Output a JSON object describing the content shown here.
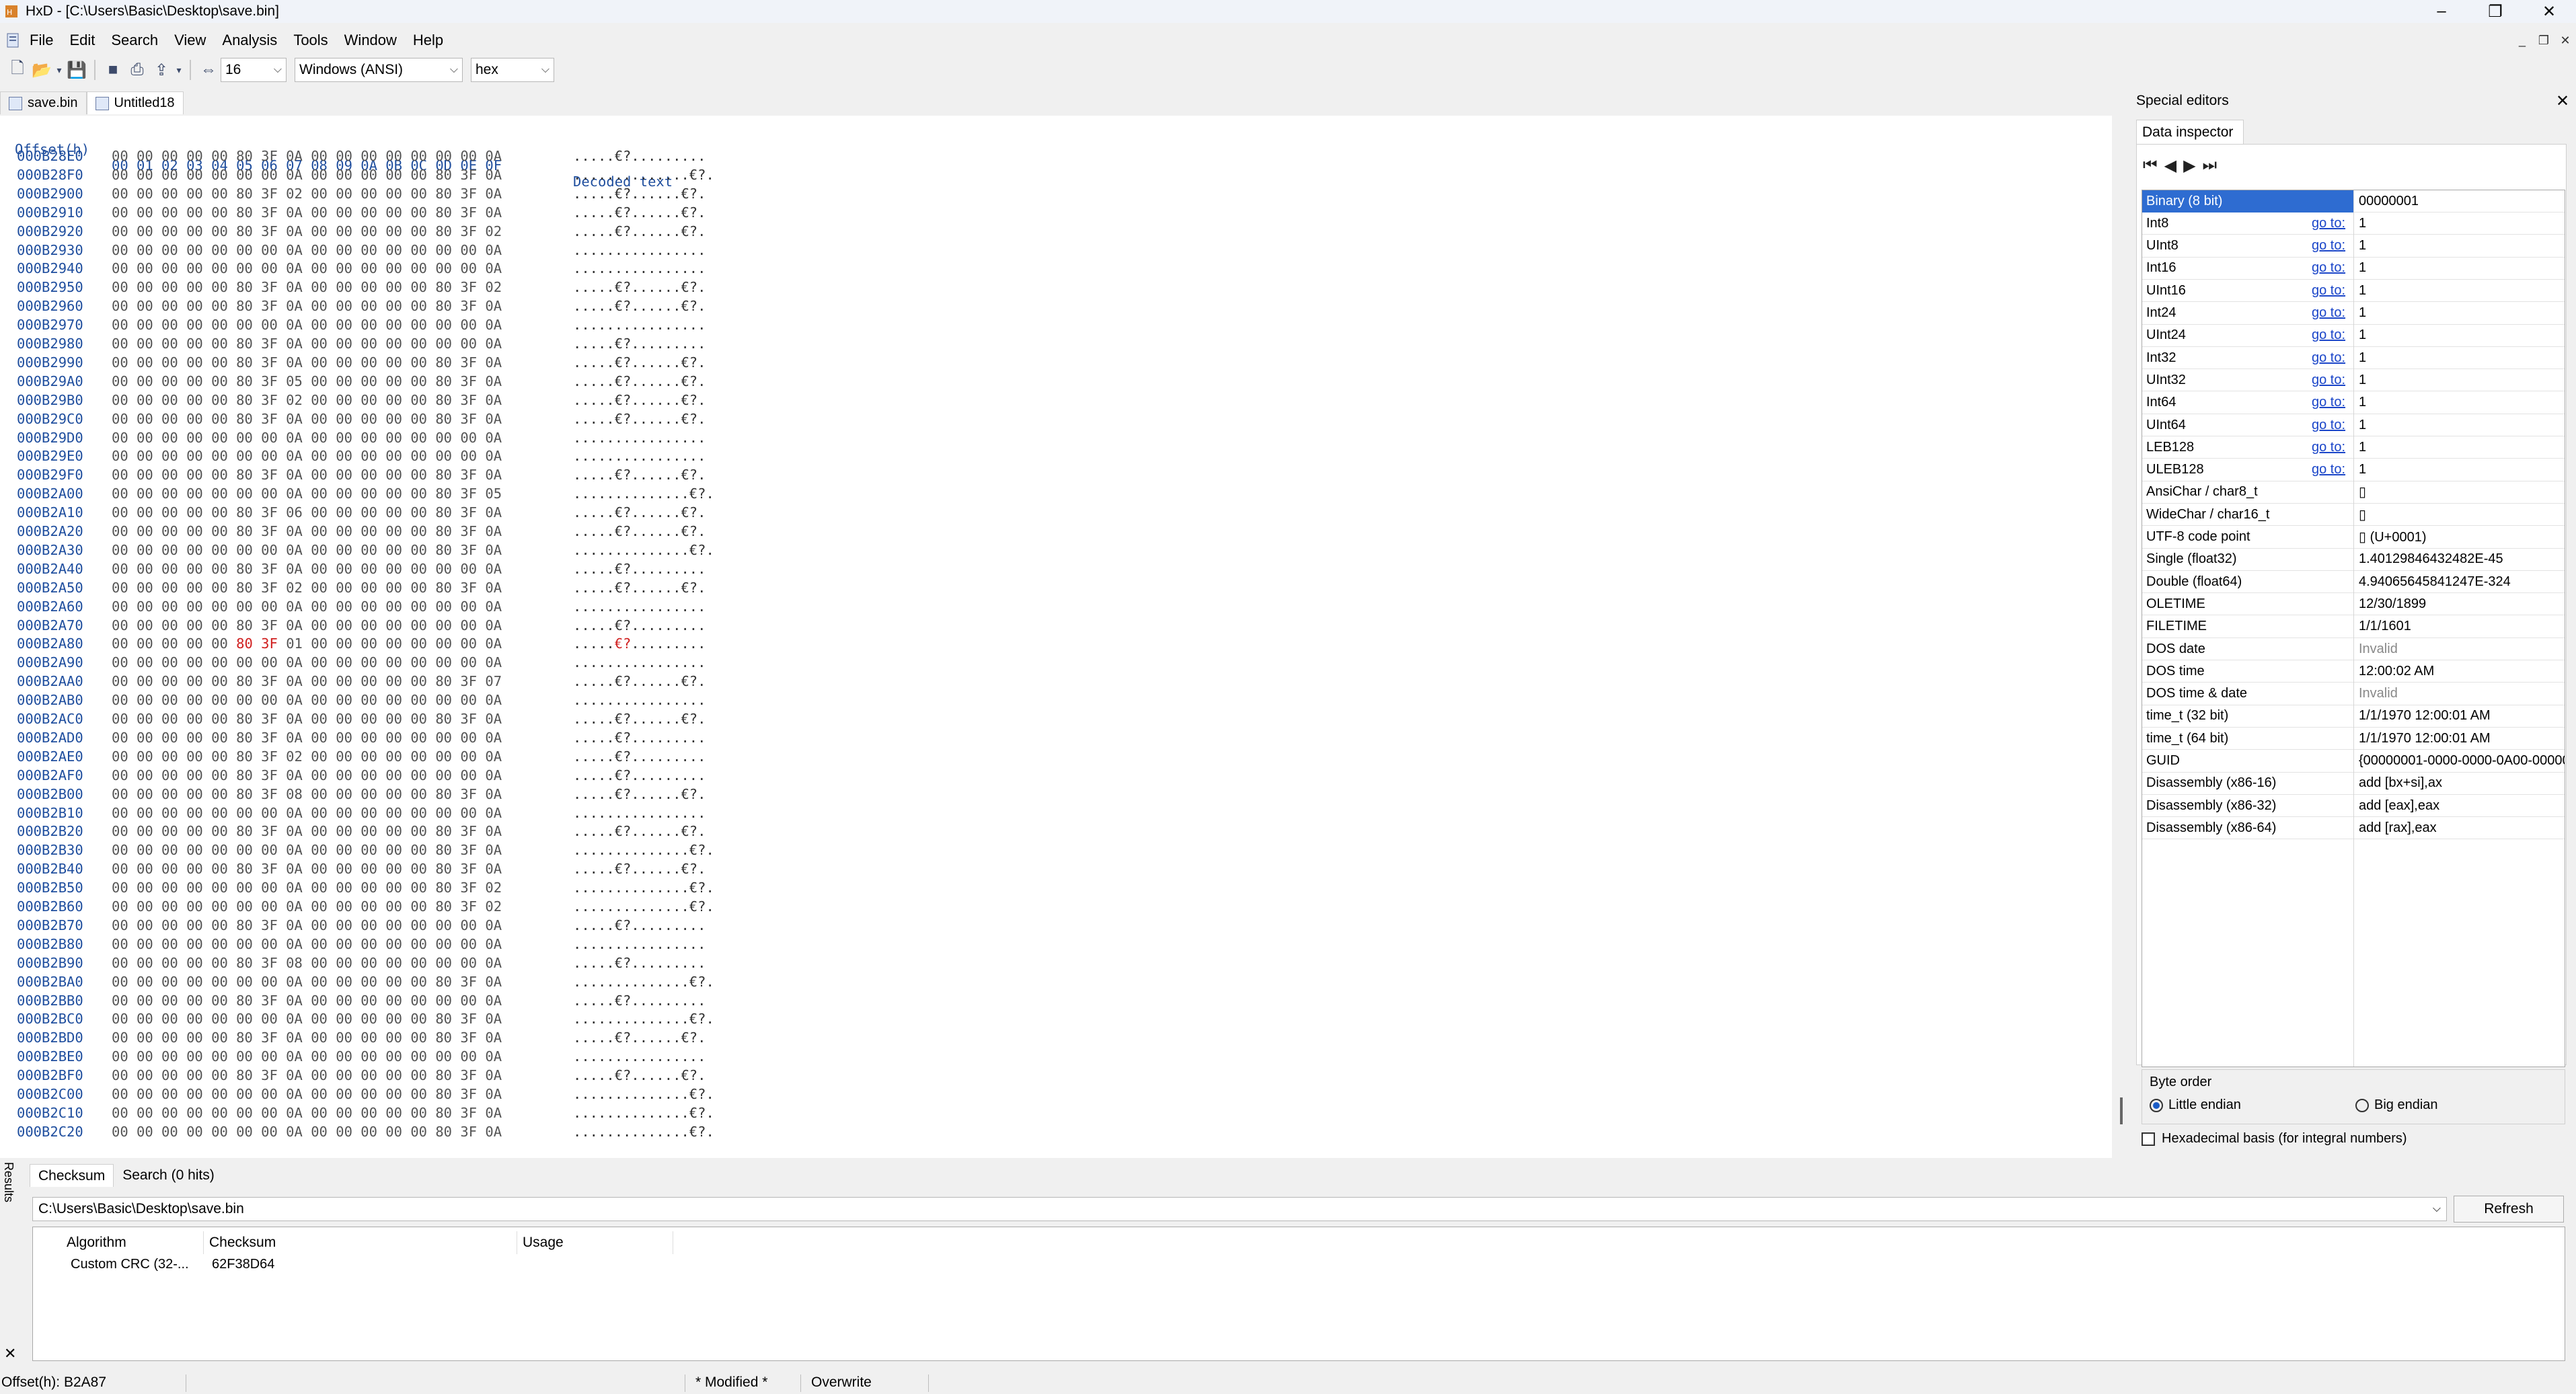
{
  "window": {
    "title": "HxD - [C:\\Users\\Basic\\Desktop\\save.bin]"
  },
  "menu": [
    "File",
    "Edit",
    "Search",
    "View",
    "Analysis",
    "Tools",
    "Window",
    "Help"
  ],
  "toolbar": {
    "bytes_per_row": "16",
    "charset": "Windows (ANSI)",
    "offset_base": "hex"
  },
  "doc_tabs": [
    {
      "label": "save.bin",
      "active": false
    },
    {
      "label": "Untitled18",
      "active": true
    }
  ],
  "hex": {
    "header_offset": "Offset(h)",
    "header_cols": "00 01 02 03 04 05 06 07 08 09 0A 0B 0C 0D 0E 0F",
    "header_decoded": "Decoded text",
    "rows": [
      [
        "000B28E0",
        "00 00 00 00 00 80 3F 0A 00 00 00 00 00 00 00 0A",
        ".....€?........."
      ],
      [
        "000B28F0",
        "00 00 00 00 00 00 00 0A 00 00 00 00 00 80 3F 0A",
        "..............€?."
      ],
      [
        "000B2900",
        "00 00 00 00 00 80 3F 02 00 00 00 00 00 80 3F 0A",
        ".....€?......€?."
      ],
      [
        "000B2910",
        "00 00 00 00 00 80 3F 0A 00 00 00 00 00 80 3F 0A",
        ".....€?......€?."
      ],
      [
        "000B2920",
        "00 00 00 00 00 80 3F 0A 00 00 00 00 00 80 3F 02",
        ".....€?......€?."
      ],
      [
        "000B2930",
        "00 00 00 00 00 00 00 0A 00 00 00 00 00 00 00 0A",
        "................"
      ],
      [
        "000B2940",
        "00 00 00 00 00 00 00 0A 00 00 00 00 00 00 00 0A",
        "................"
      ],
      [
        "000B2950",
        "00 00 00 00 00 80 3F 0A 00 00 00 00 00 80 3F 02",
        ".....€?......€?."
      ],
      [
        "000B2960",
        "00 00 00 00 00 80 3F 0A 00 00 00 00 00 80 3F 0A",
        ".....€?......€?."
      ],
      [
        "000B2970",
        "00 00 00 00 00 00 00 0A 00 00 00 00 00 00 00 0A",
        "................"
      ],
      [
        "000B2980",
        "00 00 00 00 00 80 3F 0A 00 00 00 00 00 00 00 0A",
        ".....€?........."
      ],
      [
        "000B2990",
        "00 00 00 00 00 80 3F 0A 00 00 00 00 00 80 3F 0A",
        ".....€?......€?."
      ],
      [
        "000B29A0",
        "00 00 00 00 00 80 3F 05 00 00 00 00 00 80 3F 0A",
        ".....€?......€?."
      ],
      [
        "000B29B0",
        "00 00 00 00 00 80 3F 02 00 00 00 00 00 80 3F 0A",
        ".....€?......€?."
      ],
      [
        "000B29C0",
        "00 00 00 00 00 80 3F 0A 00 00 00 00 00 80 3F 0A",
        ".....€?......€?."
      ],
      [
        "000B29D0",
        "00 00 00 00 00 00 00 0A 00 00 00 00 00 00 00 0A",
        "................"
      ],
      [
        "000B29E0",
        "00 00 00 00 00 00 00 0A 00 00 00 00 00 00 00 0A",
        "................"
      ],
      [
        "000B29F0",
        "00 00 00 00 00 80 3F 0A 00 00 00 00 00 80 3F 0A",
        ".....€?......€?."
      ],
      [
        "000B2A00",
        "00 00 00 00 00 00 00 0A 00 00 00 00 00 80 3F 05",
        "..............€?."
      ],
      [
        "000B2A10",
        "00 00 00 00 00 80 3F 06 00 00 00 00 00 80 3F 0A",
        ".....€?......€?."
      ],
      [
        "000B2A20",
        "00 00 00 00 00 80 3F 0A 00 00 00 00 00 80 3F 0A",
        ".....€?......€?."
      ],
      [
        "000B2A30",
        "00 00 00 00 00 00 00 0A 00 00 00 00 00 80 3F 0A",
        "..............€?."
      ],
      [
        "000B2A40",
        "00 00 00 00 00 80 3F 0A 00 00 00 00 00 00 00 0A",
        ".....€?........."
      ],
      [
        "000B2A50",
        "00 00 00 00 00 80 3F 02 00 00 00 00 00 80 3F 0A",
        ".....€?......€?."
      ],
      [
        "000B2A60",
        "00 00 00 00 00 00 00 0A 00 00 00 00 00 00 00 0A",
        "................"
      ],
      [
        "000B2A70",
        "00 00 00 00 00 80 3F 0A 00 00 00 00 00 00 00 0A",
        ".....€?........."
      ],
      [
        "000B2A80",
        "00 00 00 00 00 80 3F 01 00 00 00 00 00 00 00 0A",
        ".....€?........."
      ],
      [
        "000B2A90",
        "00 00 00 00 00 00 00 0A 00 00 00 00 00 00 00 0A",
        "................"
      ],
      [
        "000B2AA0",
        "00 00 00 00 00 80 3F 0A 00 00 00 00 00 80 3F 07",
        ".....€?......€?."
      ],
      [
        "000B2AB0",
        "00 00 00 00 00 00 00 0A 00 00 00 00 00 00 00 0A",
        "................"
      ],
      [
        "000B2AC0",
        "00 00 00 00 00 80 3F 0A 00 00 00 00 00 80 3F 0A",
        ".....€?......€?."
      ],
      [
        "000B2AD0",
        "00 00 00 00 00 80 3F 0A 00 00 00 00 00 00 00 0A",
        ".....€?........."
      ],
      [
        "000B2AE0",
        "00 00 00 00 00 80 3F 02 00 00 00 00 00 00 00 0A",
        ".....€?........."
      ],
      [
        "000B2AF0",
        "00 00 00 00 00 80 3F 0A 00 00 00 00 00 00 00 0A",
        ".....€?........."
      ],
      [
        "000B2B00",
        "00 00 00 00 00 80 3F 08 00 00 00 00 00 80 3F 0A",
        ".....€?......€?."
      ],
      [
        "000B2B10",
        "00 00 00 00 00 00 00 0A 00 00 00 00 00 00 00 0A",
        "................"
      ],
      [
        "000B2B20",
        "00 00 00 00 00 80 3F 0A 00 00 00 00 00 80 3F 0A",
        ".....€?......€?."
      ],
      [
        "000B2B30",
        "00 00 00 00 00 00 00 0A 00 00 00 00 00 80 3F 0A",
        "..............€?."
      ],
      [
        "000B2B40",
        "00 00 00 00 00 80 3F 0A 00 00 00 00 00 80 3F 0A",
        ".....€?......€?."
      ],
      [
        "000B2B50",
        "00 00 00 00 00 00 00 0A 00 00 00 00 00 80 3F 02",
        "..............€?."
      ],
      [
        "000B2B60",
        "00 00 00 00 00 00 00 0A 00 00 00 00 00 80 3F 02",
        "..............€?."
      ],
      [
        "000B2B70",
        "00 00 00 00 00 80 3F 0A 00 00 00 00 00 00 00 0A",
        ".....€?........."
      ],
      [
        "000B2B80",
        "00 00 00 00 00 00 00 0A 00 00 00 00 00 00 00 0A",
        "................"
      ],
      [
        "000B2B90",
        "00 00 00 00 00 80 3F 08 00 00 00 00 00 00 00 0A",
        ".....€?........."
      ],
      [
        "000B2BA0",
        "00 00 00 00 00 00 00 0A 00 00 00 00 00 80 3F 0A",
        "..............€?."
      ],
      [
        "000B2BB0",
        "00 00 00 00 00 80 3F 0A 00 00 00 00 00 00 00 0A",
        ".....€?........."
      ],
      [
        "000B2BC0",
        "00 00 00 00 00 00 00 0A 00 00 00 00 00 80 3F 0A",
        "..............€?."
      ],
      [
        "000B2BD0",
        "00 00 00 00 00 80 3F 0A 00 00 00 00 00 80 3F 0A",
        ".....€?......€?."
      ],
      [
        "000B2BE0",
        "00 00 00 00 00 00 00 0A 00 00 00 00 00 00 00 0A",
        "................"
      ],
      [
        "000B2BF0",
        "00 00 00 00 00 80 3F 0A 00 00 00 00 00 80 3F 0A",
        ".....€?......€?."
      ],
      [
        "000B2C00",
        "00 00 00 00 00 00 00 0A 00 00 00 00 00 80 3F 0A",
        "..............€?."
      ],
      [
        "000B2C10",
        "00 00 00 00 00 00 00 0A 00 00 00 00 00 80 3F 0A",
        "..............€?."
      ],
      [
        "000B2C20",
        "00 00 00 00 00 00 00 0A 00 00 00 00 00 80 3F 0A",
        "..............€?."
      ]
    ]
  },
  "special_editors": {
    "title": "Special editors",
    "tab": "Data inspector",
    "goto_label": "go to:",
    "rows": [
      {
        "name": "Binary (8 bit)",
        "goto": false,
        "value": "00000001",
        "selected": true
      },
      {
        "name": "Int8",
        "goto": true,
        "value": "1"
      },
      {
        "name": "UInt8",
        "goto": true,
        "value": "1"
      },
      {
        "name": "Int16",
        "goto": true,
        "value": "1"
      },
      {
        "name": "UInt16",
        "goto": true,
        "value": "1"
      },
      {
        "name": "Int24",
        "goto": true,
        "value": "1"
      },
      {
        "name": "UInt24",
        "goto": true,
        "value": "1"
      },
      {
        "name": "Int32",
        "goto": true,
        "value": "1"
      },
      {
        "name": "UInt32",
        "goto": true,
        "value": "1"
      },
      {
        "name": "Int64",
        "goto": true,
        "value": "1"
      },
      {
        "name": "UInt64",
        "goto": true,
        "value": "1"
      },
      {
        "name": "LEB128",
        "goto": true,
        "value": "1"
      },
      {
        "name": "ULEB128",
        "goto": true,
        "value": "1"
      },
      {
        "name": "AnsiChar / char8_t",
        "goto": false,
        "value": "▯"
      },
      {
        "name": "WideChar / char16_t",
        "goto": false,
        "value": "▯"
      },
      {
        "name": "UTF-8 code point",
        "goto": false,
        "value": "▯ (U+0001)"
      },
      {
        "name": "Single (float32)",
        "goto": false,
        "value": "1.40129846432482E-45"
      },
      {
        "name": "Double (float64)",
        "goto": false,
        "value": "4.94065645841247E-324"
      },
      {
        "name": "OLETIME",
        "goto": false,
        "value": "12/30/1899"
      },
      {
        "name": "FILETIME",
        "goto": false,
        "value": "1/1/1601"
      },
      {
        "name": "DOS date",
        "goto": false,
        "value": "Invalid",
        "invalid": true
      },
      {
        "name": "DOS time",
        "goto": false,
        "value": "12:00:02 AM"
      },
      {
        "name": "DOS time & date",
        "goto": false,
        "value": "Invalid",
        "invalid": true
      },
      {
        "name": "time_t (32 bit)",
        "goto": false,
        "value": "1/1/1970 12:00:01 AM"
      },
      {
        "name": "time_t (64 bit)",
        "goto": false,
        "value": "1/1/1970 12:00:01 AM"
      },
      {
        "name": "GUID",
        "goto": false,
        "value": "{00000001-0000-0000-0A00-000000"
      },
      {
        "name": "Disassembly (x86-16)",
        "goto": false,
        "value": "add [bx+si],ax"
      },
      {
        "name": "Disassembly (x86-32)",
        "goto": false,
        "value": "add [eax],eax"
      },
      {
        "name": "Disassembly (x86-64)",
        "goto": false,
        "value": "add [rax],eax"
      }
    ],
    "byte_order_label": "Byte order",
    "little_endian": "Little endian",
    "big_endian": "Big endian",
    "hex_basis": "Hexadecimal basis (for integral numbers)"
  },
  "results": {
    "side_label": "Results",
    "tabs": [
      "Checksum",
      "Search (0 hits)"
    ],
    "path": "C:\\Users\\Basic\\Desktop\\save.bin",
    "refresh": "Refresh",
    "columns": [
      "Algorithm",
      "Checksum",
      "Usage"
    ],
    "row": {
      "algorithm": "Custom CRC (32-...",
      "checksum": "62F38D64",
      "usage": ""
    }
  },
  "status": {
    "offset": "Offset(h): B2A87",
    "modified": "* Modified *",
    "mode": "Overwrite"
  }
}
